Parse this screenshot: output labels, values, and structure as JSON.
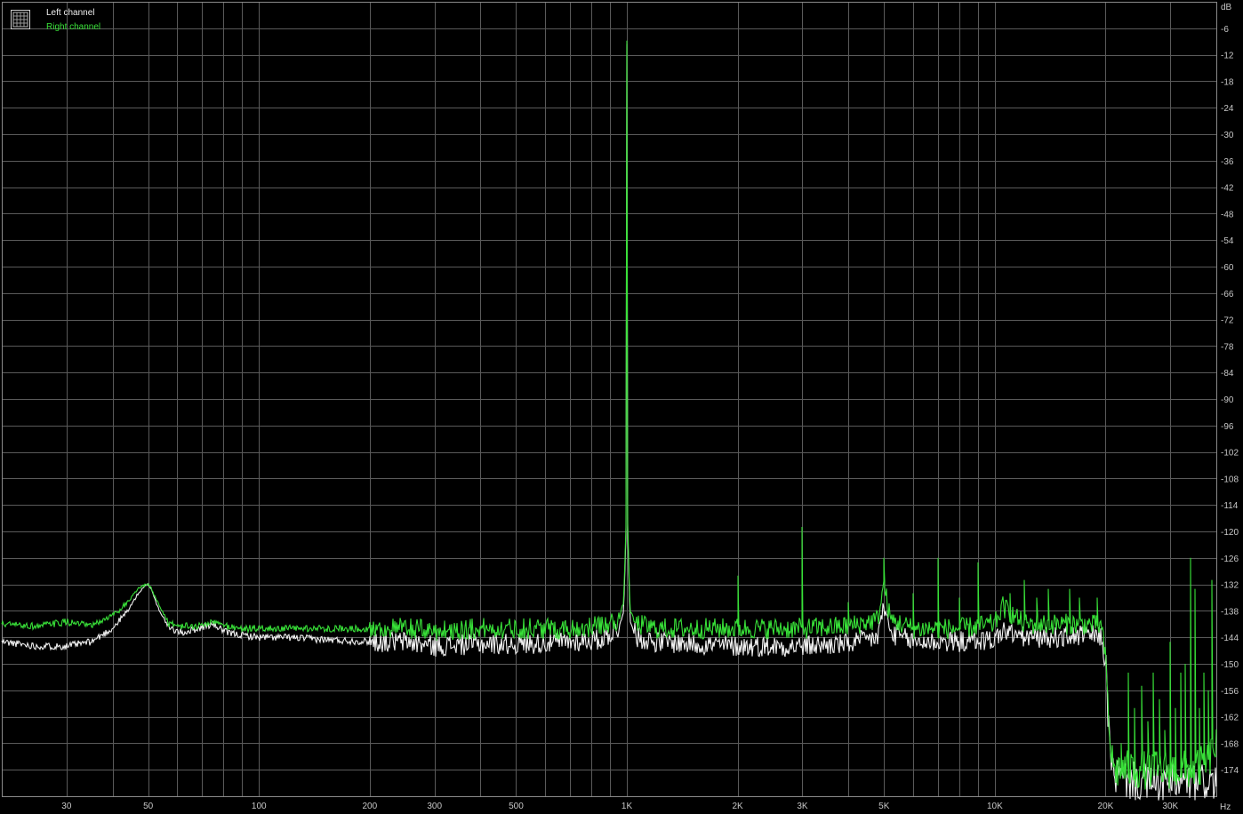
{
  "chart_data": {
    "type": "line",
    "x_scale": "log",
    "y_scale": "linear",
    "xlim": [
      20,
      40000
    ],
    "ylim": [
      -180,
      0
    ],
    "grid": true,
    "legend_placement": "top-left",
    "x_unit": "Hz",
    "y_unit": "dB",
    "x_ticks": [
      {
        "value": 30,
        "label": "30"
      },
      {
        "value": 50,
        "label": "50"
      },
      {
        "value": 100,
        "label": "100"
      },
      {
        "value": 200,
        "label": "200"
      },
      {
        "value": 300,
        "label": "300"
      },
      {
        "value": 500,
        "label": "500"
      },
      {
        "value": 1000,
        "label": "1K"
      },
      {
        "value": 2000,
        "label": "2K"
      },
      {
        "value": 3000,
        "label": "3K"
      },
      {
        "value": 5000,
        "label": "5K"
      },
      {
        "value": 10000,
        "label": "10K"
      },
      {
        "value": 20000,
        "label": "20K"
      },
      {
        "value": 30000,
        "label": "30K"
      }
    ],
    "y_ticks": [
      -6,
      -12,
      -18,
      -24,
      -30,
      -36,
      -42,
      -48,
      -54,
      -60,
      -66,
      -72,
      -78,
      -84,
      -90,
      -96,
      -102,
      -108,
      -114,
      -120,
      -126,
      -132,
      -138,
      -144,
      -150,
      -156,
      -162,
      -168,
      -174
    ],
    "series": [
      {
        "name": "Left channel",
        "color": "#f0f0f0",
        "x": [
          20,
          25,
          30,
          35,
          40,
          44,
          47,
          49,
          50,
          51,
          53,
          57,
          62,
          68,
          75,
          82,
          90,
          100,
          120,
          150,
          200,
          250,
          300,
          400,
          500,
          700,
          850,
          950,
          980,
          995,
          1000,
          1005,
          1020,
          1060,
          1200,
          1500,
          2000,
          3000,
          4000,
          4800,
          5000,
          5200,
          6000,
          8000,
          10000,
          10500,
          12000,
          15000,
          18000,
          19500,
          20000,
          20500,
          21000,
          22000,
          25000,
          30000,
          35000,
          38000,
          40000
        ],
        "y": [
          -145,
          -146,
          -146,
          -145,
          -142,
          -138,
          -134,
          -132.5,
          -132,
          -133,
          -137,
          -142,
          -143,
          -142,
          -141,
          -143,
          -143.5,
          -144,
          -144,
          -144.5,
          -145,
          -145,
          -146,
          -145.5,
          -145.5,
          -145,
          -144.5,
          -142,
          -138,
          -120,
          -3,
          -120,
          -140,
          -144,
          -145,
          -145.5,
          -146,
          -146,
          -145.5,
          -144,
          -137,
          -143,
          -145,
          -145,
          -144.5,
          -142.5,
          -144,
          -144,
          -143.5,
          -144,
          -150,
          -168,
          -175,
          -176,
          -177,
          -177,
          -177,
          -176.5,
          -177
        ]
      },
      {
        "name": "Right channel",
        "color": "#38e038",
        "x": [
          20,
          25,
          30,
          35,
          40,
          44,
          47,
          49,
          50,
          51,
          53,
          57,
          62,
          68,
          75,
          82,
          90,
          100,
          120,
          150,
          200,
          250,
          300,
          400,
          500,
          700,
          850,
          950,
          980,
          995,
          1000,
          1005,
          1020,
          1060,
          1200,
          1500,
          2000,
          3000,
          4000,
          4800,
          5000,
          5200,
          6000,
          8000,
          10000,
          10500,
          12000,
          15000,
          18000,
          19500,
          20000,
          20500,
          21000,
          22000,
          25000,
          30000,
          35000,
          38000,
          40000
        ],
        "y": [
          -141,
          -141.5,
          -140.5,
          -141.5,
          -139,
          -136,
          -133,
          -132.2,
          -132,
          -133,
          -136,
          -141,
          -141.5,
          -141.5,
          -140.5,
          -141.5,
          -142,
          -142,
          -142,
          -142,
          -142,
          -142,
          -142.5,
          -142,
          -142,
          -142,
          -141.5,
          -140,
          -136,
          -118,
          -2,
          -118,
          -138,
          -141,
          -142,
          -142,
          -142,
          -142,
          -141.5,
          -140,
          -132,
          -140,
          -142,
          -142,
          -141,
          -137,
          -141,
          -141,
          -141,
          -141.5,
          -149,
          -166,
          -174,
          -174,
          -174,
          -174,
          -174,
          -172,
          -168
        ]
      }
    ],
    "spurs": [
      {
        "series": "Right channel",
        "x": 2000,
        "y": -130
      },
      {
        "series": "Right channel",
        "x": 3000,
        "y": -119
      },
      {
        "series": "Right channel",
        "x": 4000,
        "y": -136
      },
      {
        "series": "Right channel",
        "x": 5000,
        "y": -126
      },
      {
        "series": "Right channel",
        "x": 6000,
        "y": -134
      },
      {
        "series": "Right channel",
        "x": 7000,
        "y": -126
      },
      {
        "series": "Right channel",
        "x": 8000,
        "y": -135
      },
      {
        "series": "Right channel",
        "x": 9000,
        "y": -127
      },
      {
        "series": "Right channel",
        "x": 11000,
        "y": -134
      },
      {
        "series": "Right channel",
        "x": 12000,
        "y": -131
      },
      {
        "series": "Right channel",
        "x": 13000,
        "y": -135
      },
      {
        "series": "Right channel",
        "x": 14000,
        "y": -133
      },
      {
        "series": "Right channel",
        "x": 16000,
        "y": -133
      },
      {
        "series": "Right channel",
        "x": 17000,
        "y": -135
      },
      {
        "series": "Right channel",
        "x": 19000,
        "y": -135
      },
      {
        "series": "Right channel",
        "x": 22000,
        "y": -168
      },
      {
        "series": "Right channel",
        "x": 23000,
        "y": -152
      },
      {
        "series": "Right channel",
        "x": 24000,
        "y": -160
      },
      {
        "series": "Right channel",
        "x": 25000,
        "y": -155
      },
      {
        "series": "Right channel",
        "x": 26000,
        "y": -163
      },
      {
        "series": "Right channel",
        "x": 27000,
        "y": -152
      },
      {
        "series": "Right channel",
        "x": 28000,
        "y": -158
      },
      {
        "series": "Right channel",
        "x": 29000,
        "y": -165
      },
      {
        "series": "Right channel",
        "x": 30000,
        "y": -145
      },
      {
        "series": "Right channel",
        "x": 31000,
        "y": -160
      },
      {
        "series": "Right channel",
        "x": 32000,
        "y": -152
      },
      {
        "series": "Right channel",
        "x": 33000,
        "y": -150
      },
      {
        "series": "Right channel",
        "x": 34000,
        "y": -126
      },
      {
        "series": "Right channel",
        "x": 35000,
        "y": -133
      },
      {
        "series": "Right channel",
        "x": 36000,
        "y": -160
      },
      {
        "series": "Right channel",
        "x": 37000,
        "y": -152
      },
      {
        "series": "Right channel",
        "x": 38000,
        "y": -156
      },
      {
        "series": "Right channel",
        "x": 39000,
        "y": -131
      }
    ]
  },
  "legend": {
    "left_label": "Left channel",
    "right_label": "Right channel",
    "left_color": "#f0f0f0",
    "right_color": "#38e038",
    "icon": "grid-icon"
  }
}
